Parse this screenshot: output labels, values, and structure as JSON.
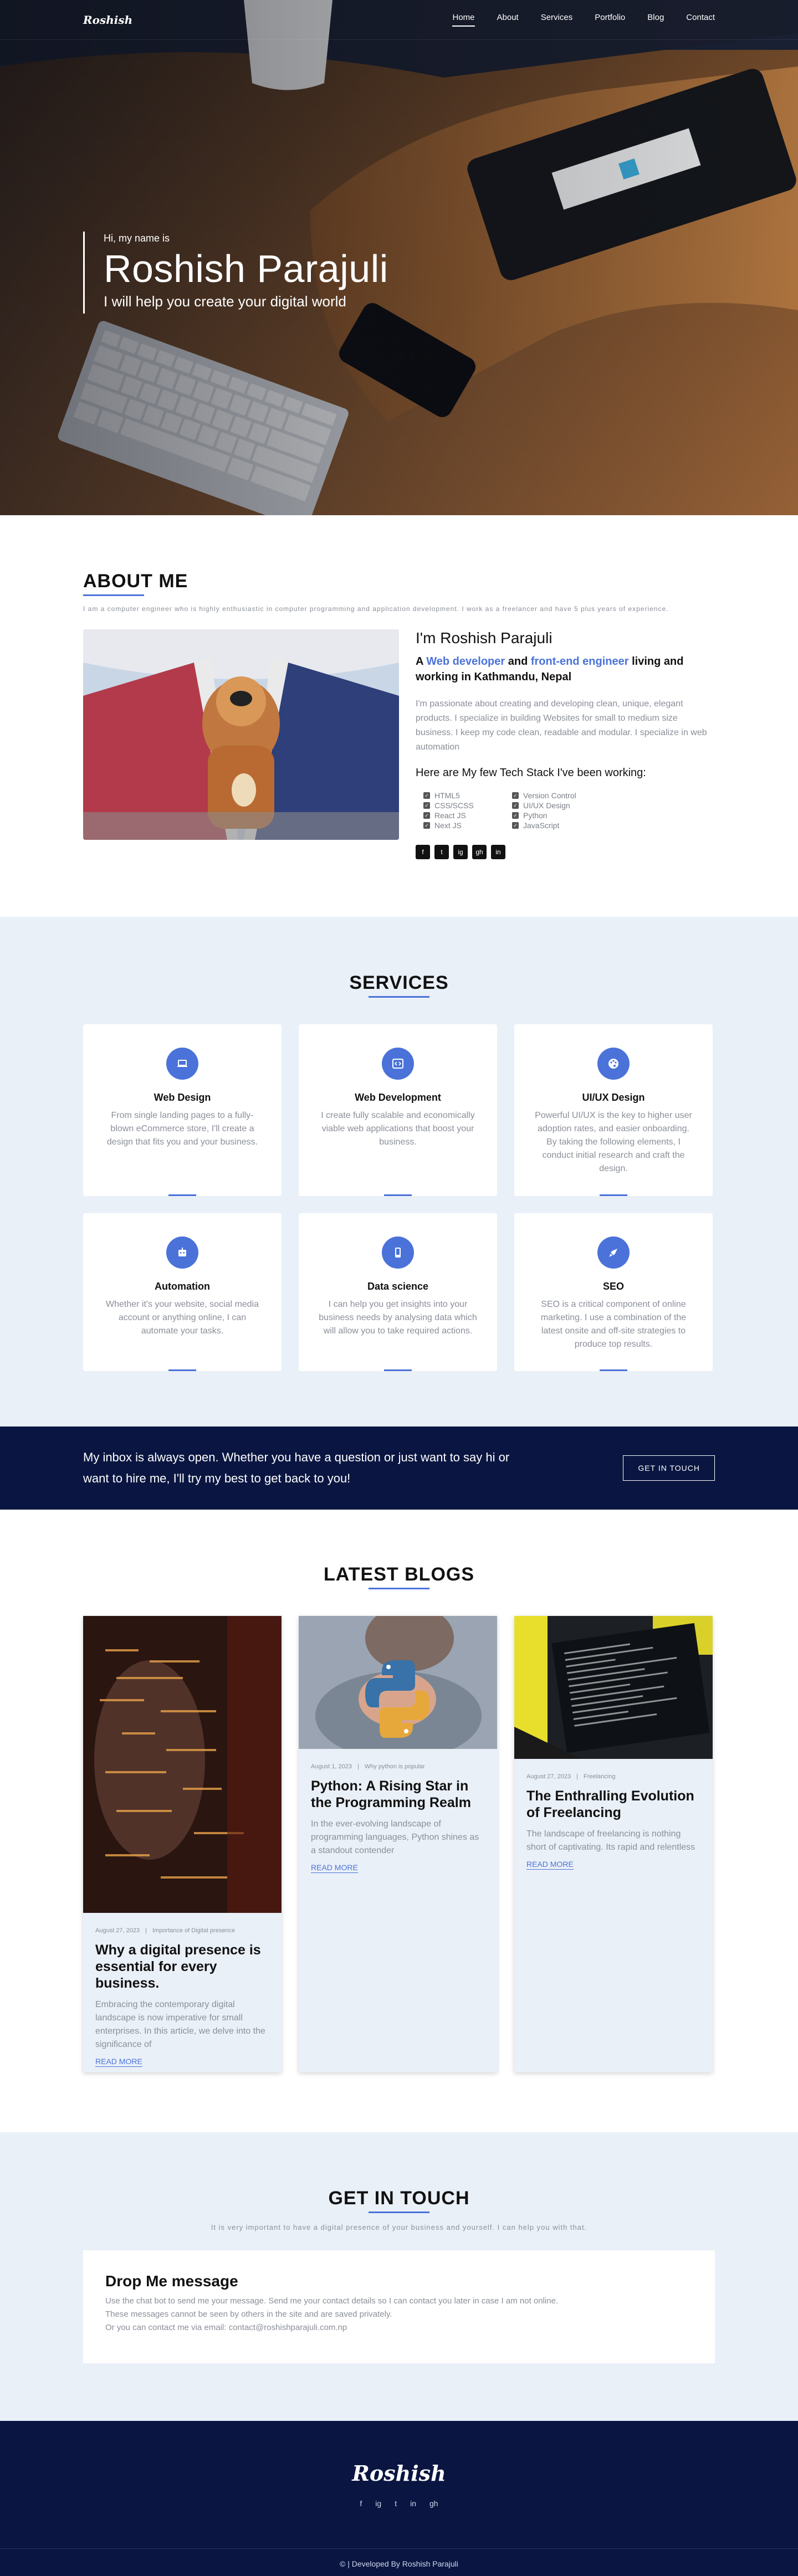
{
  "nav": {
    "logo": "Roshish",
    "links": [
      "Home",
      "About",
      "Services",
      "Portfolio",
      "Blog",
      "Contact"
    ]
  },
  "hero": {
    "greeting": "Hi, my name is",
    "name": "Roshish Parajuli",
    "tagline": "I will help you create your digital world"
  },
  "about": {
    "title": "ABOUT ME",
    "intro": "I am a computer engineer who is highly enthusiastic in computer programming and application development. I work as a freelancer and have 5 plus years of experience.",
    "heading": "I'm Roshish Parajuli",
    "role_prefix": "A",
    "role_web": "Web developer",
    "role_and": "and",
    "role_fe": "front-end engineer",
    "role_suffix": "living and working in Kathmandu, Nepal",
    "description": "I'm passionate about creating and developing clean, unique, elegant products. I specialize in building Websites for small to medium size business. I keep my code clean, readable and modular. I specialize in web automation",
    "stack_heading": "Here are My few Tech Stack I've been working:",
    "stack": [
      "HTML5",
      "Version Control",
      "CSS/SCSS",
      "UI/UX Design",
      "React JS",
      "Python",
      "Next JS",
      "JavaScript"
    ],
    "socials": [
      "f",
      "t",
      "ig",
      "gh",
      "in"
    ]
  },
  "services": {
    "title": "SERVICES",
    "items": [
      {
        "title": "Web Design",
        "desc": "From single landing pages to a fully-blown eCommerce store, I'll create a design that fits you and your business."
      },
      {
        "title": "Web Development",
        "desc": "I create fully scalable and economically viable web applications that boost your business."
      },
      {
        "title": "UI/UX Design",
        "desc": "Powerful UI/UX is the key to higher user adoption rates, and easier onboarding. By taking the following elements, I conduct initial research and craft the design."
      },
      {
        "title": "Automation",
        "desc": "Whether it's your website, social media account or anything online, I can automate your tasks."
      },
      {
        "title": "Data science",
        "desc": "I can help you get insights into your business needs by analysing data which will allow you to take required actions."
      },
      {
        "title": "SEO",
        "desc": "SEO is a critical component of online marketing. I use a combination of the latest onsite and off-site strategies to produce top results."
      }
    ]
  },
  "cta": {
    "text": "My inbox is always open. Whether you have a question or just want to say hi or want to hire me, I'll try my best to get back to you!",
    "button": "GET IN TOUCH"
  },
  "blogs": {
    "title": "LATEST BLOGS",
    "read_more": "READ MORE",
    "items": [
      {
        "date": "August 27, 2023",
        "category": "Importance of Digital presence",
        "title": "Why a digital presence is essential for every business.",
        "excerpt": "Embracing the contemporary digital landscape is now imperative for small enterprises. In this article, we delve into the significance of"
      },
      {
        "date": "August 1, 2023",
        "category": "Why python is popular",
        "title": "Python: A Rising Star in the Programming Realm",
        "excerpt": "In the ever-evolving landscape of programming languages, Python shines as a standout contender"
      },
      {
        "date": "August 27, 2023",
        "category": "Freelancing",
        "title": "The Enthralling Evolution of Freelancing",
        "excerpt": "The landscape of freelancing is nothing short of captivating. Its rapid and relentless"
      }
    ]
  },
  "contact": {
    "title": "GET IN TOUCH",
    "subtitle": "It is very important to have a digital presence of your business and yourself. I can help you with that.",
    "box_title": "Drop Me message",
    "lines": [
      "Use the chat bot to send me your message. Send me your contact details so I can contact you later in case I am not online.",
      "These messages cannot be seen by others in the site and are saved privately.",
      "Or you can contact me via email: contact@roshishparajuli.com.np"
    ]
  },
  "footer": {
    "logo": "Roshish",
    "icons": [
      "f",
      "ig",
      "t",
      "in",
      "gh"
    ],
    "copyright": "© | Developed By Roshish Parajuli"
  },
  "colors": {
    "accent": "#4a72d9",
    "navy": "#0a1641",
    "light_bg": "#eaf0f8"
  }
}
